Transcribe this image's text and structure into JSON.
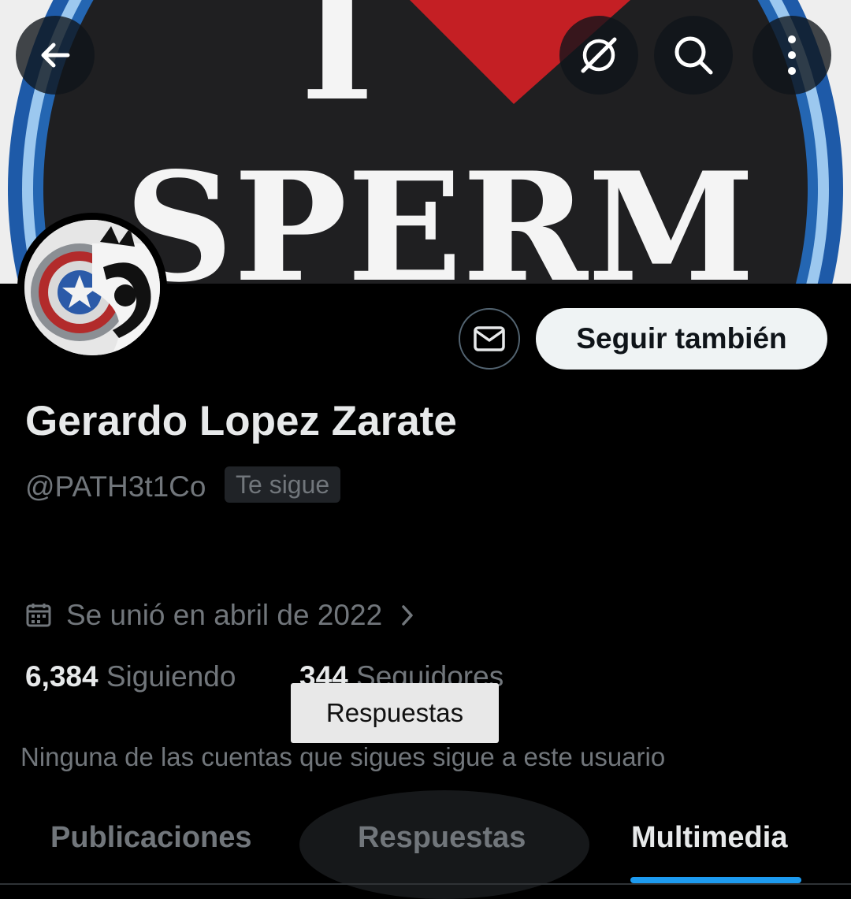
{
  "header": {
    "back_icon": "arrow-left-icon",
    "grok_icon": "grok-icon",
    "search_icon": "search-icon",
    "more_icon": "more-vertical-icon"
  },
  "banner": {
    "text_top": "I",
    "text_main": "SPERM"
  },
  "profile": {
    "name": "Gerardo Lopez Zarate",
    "handle": "@PATH3t1Co",
    "follows_you": "Te sigue",
    "joined": "Se unió en abril de 2022",
    "following_count": "6,384",
    "following_label": "Siguiendo",
    "followers_count": "344",
    "followers_label": "Seguidores",
    "mutuals_note": "Ninguna de las cuentas que sigues sigue a este usuario"
  },
  "actions": {
    "message_icon": "mail-icon",
    "follow_label": "Seguir también"
  },
  "tooltip": {
    "text": "Respuestas"
  },
  "tabs": [
    {
      "label": "Publicaciones",
      "active": false
    },
    {
      "label": "Respuestas",
      "active": false
    },
    {
      "label": "Multimedia",
      "active": true
    }
  ],
  "colors": {
    "accent": "#1d9bf0",
    "background": "#000000",
    "muted": "#71767b"
  }
}
